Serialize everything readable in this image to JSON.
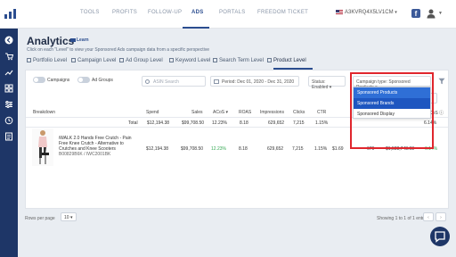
{
  "nav": {
    "tools": "TOOLS",
    "profits": "PROFITS",
    "follow_up": "FOLLOW-UP",
    "ads": "ADS",
    "portals": "PORTALS",
    "freedom_ticket": "FREEDOM TICKET",
    "account": "A3KVRQ4X5LV1CM"
  },
  "page": {
    "title": "Analytics",
    "learn": "Learn",
    "subtitle": "Click on each \"Level\" to view your Sponsored Ads campaign data from a specific perspective"
  },
  "levels": [
    "Portfolio Level",
    "Campaign Level",
    "Ad Group Level",
    "Keyword Level",
    "Search Term Level",
    "Product Level"
  ],
  "filters": {
    "campaigns": "Campaigns",
    "ad_groups": "Ad Groups",
    "search_placeholder": "ASIN Search",
    "period": "Period: Dec 01, 2020 - Dec 31, 2020",
    "status": "Status: Enabled",
    "campaign_type": "Campaign type: Sponsored Products",
    "options": [
      "Sponsored Products",
      "Sponsored Brands",
      "Sponsored Display"
    ],
    "export": "Export"
  },
  "table": {
    "headers": [
      "Breakdown",
      "Spend",
      "Sales",
      "ACoS",
      "ROAS",
      "Impressions",
      "Clicks",
      "CTR",
      "TACoS"
    ],
    "total_label": "Total",
    "total": [
      "$12,194.38",
      "$99,708.50",
      "12.23%",
      "8.18",
      "629,652",
      "7,215",
      "1.15%",
      "6.14%"
    ],
    "row": {
      "name": "iWALK 2.0 Hands Free Crutch - Pain Free Knee Crutch - Alternative to Crutches and Knee Scooters",
      "ids": "B00829B6K / IWC2001BK",
      "spend": "$12,194.38",
      "sales": "$99,708.50",
      "acos": "12.23%",
      "roas": "8.18",
      "impressions": "629,652",
      "clicks": "7,215",
      "ctr": "1.15%",
      "cpc": "$1.69",
      "orders": "679",
      "total_sales": "$1,588,748.08",
      "tacos": "6.14%"
    }
  },
  "footer": {
    "rows_per_page": "Rows per page",
    "rows_value": "10",
    "showing": "Showing 1 to 1 of 1 entries",
    "page": "1"
  },
  "colors": {
    "sidebar": "#1e3667",
    "accent": "#2b4d8f",
    "highlight": "#e0262d",
    "selected": "#2f6fd6"
  }
}
